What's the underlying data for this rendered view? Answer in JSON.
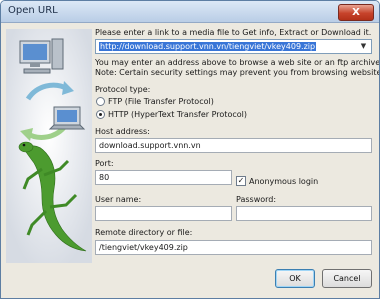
{
  "window": {
    "title": "Open URL",
    "close_glyph": "X"
  },
  "intro": "Please enter a link to a media file to Get info, Extract or Download it.",
  "url": {
    "value": "http://download.support.vnn.vn/tiengviet/vkey409.zip"
  },
  "note_line1": "You may enter an address above to browse a web site or an ftp archive.",
  "note_line2": "Note: Certain security settings may prevent you from browsing website folders.",
  "protocol": {
    "label": "Protocol type:",
    "options": [
      {
        "label": "FTP (File Transfer Protocol)",
        "selected": false
      },
      {
        "label": "HTTP (HyperText Transfer Protocol)",
        "selected": true
      }
    ]
  },
  "host": {
    "label": "Host address:",
    "value": "download.support.vnn.vn"
  },
  "port": {
    "label": "Port:",
    "value": "80"
  },
  "anonymous": {
    "label": "Anonymous login",
    "checked": true
  },
  "username": {
    "label": "User name:",
    "value": ""
  },
  "password": {
    "label": "Password:",
    "value": ""
  },
  "remote": {
    "label": "Remote directory or file:",
    "value": "/tiengviet/vkey409.zip"
  },
  "buttons": {
    "ok": "OK",
    "cancel": "Cancel"
  },
  "colors": {
    "title_text": "#1e2f48",
    "selection": "#3875d7",
    "close": "#c7432b",
    "lizard": "#4c9b2f"
  },
  "icons": [
    "computer-icon",
    "laptop-icon",
    "sync-arrows-icon",
    "lizard-icon"
  ]
}
